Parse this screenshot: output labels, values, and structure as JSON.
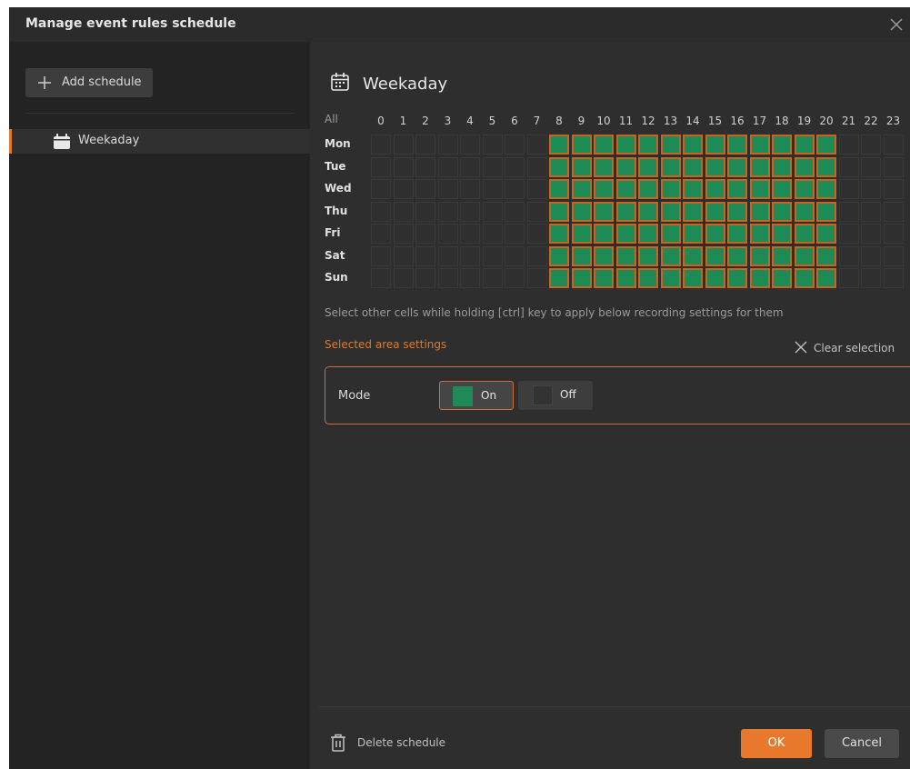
{
  "window": {
    "title": "Manage event rules schedule"
  },
  "sidebar": {
    "add_label": "Add schedule",
    "items": [
      {
        "label": "Weekaday",
        "selected": true
      }
    ]
  },
  "schedule": {
    "title": "Weekaday",
    "all_label": "All",
    "hours": [
      "0",
      "1",
      "2",
      "3",
      "4",
      "5",
      "6",
      "7",
      "8",
      "9",
      "10",
      "11",
      "12",
      "13",
      "14",
      "15",
      "16",
      "17",
      "18",
      "19",
      "20",
      "21",
      "22",
      "23"
    ],
    "days": [
      "Mon",
      "Tue",
      "Wed",
      "Thu",
      "Fri",
      "Sat",
      "Sun"
    ],
    "active_hours": [
      8,
      9,
      10,
      11,
      12,
      13,
      14,
      15,
      16,
      17,
      18,
      19,
      20
    ],
    "hint": "Select other cells while holding [ctrl] key to apply below recording settings for them",
    "selected_area_label": "Selected area settings",
    "clear_label": "Clear selection",
    "mode_label": "Mode",
    "on_label": "On",
    "off_label": "Off",
    "selected_mode": "On"
  },
  "footer": {
    "delete_label": "Delete schedule",
    "ok_label": "OK",
    "cancel_label": "Cancel"
  },
  "colors": {
    "accent": "#e8782b",
    "on_cell": "#1e8a55",
    "background": "#2e2e2e"
  }
}
